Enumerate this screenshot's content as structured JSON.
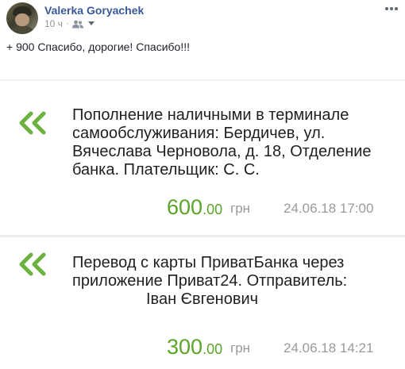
{
  "post": {
    "author": "Valerka Goryachek",
    "time": "10 ч",
    "audience_icon": "friends-icon",
    "text": "+ 900 Спасибо, дорогие! Спасибо!!!"
  },
  "colors": {
    "author_link": "#385898",
    "amount_green": "#5aa52a",
    "chevron_green": "#6cb33e",
    "muted_gray": "#9a9a9a"
  },
  "transactions": [
    {
      "icon": "double-chevron-left-icon",
      "description_lines": [
        "Пополнение наличными в терминале",
        "самообслуживания: Бердичев, ул.",
        "Вячеслава Черновола, д. 18, Отделение",
        "банка. Плательщик:  С. С."
      ],
      "amount_int": "600",
      "amount_dec": ".00",
      "currency": "грн",
      "datetime": "24.06.18 17:00"
    },
    {
      "icon": "double-chevron-left-icon",
      "description_lines": [
        "Перевод с карты ПриватБанка через",
        "приложение Приват24. Отправитель:",
        "Іван Євгенович"
      ],
      "amount_int": "300",
      "amount_dec": ".00",
      "currency": "грн",
      "datetime": "24.06.18 14:21"
    }
  ]
}
